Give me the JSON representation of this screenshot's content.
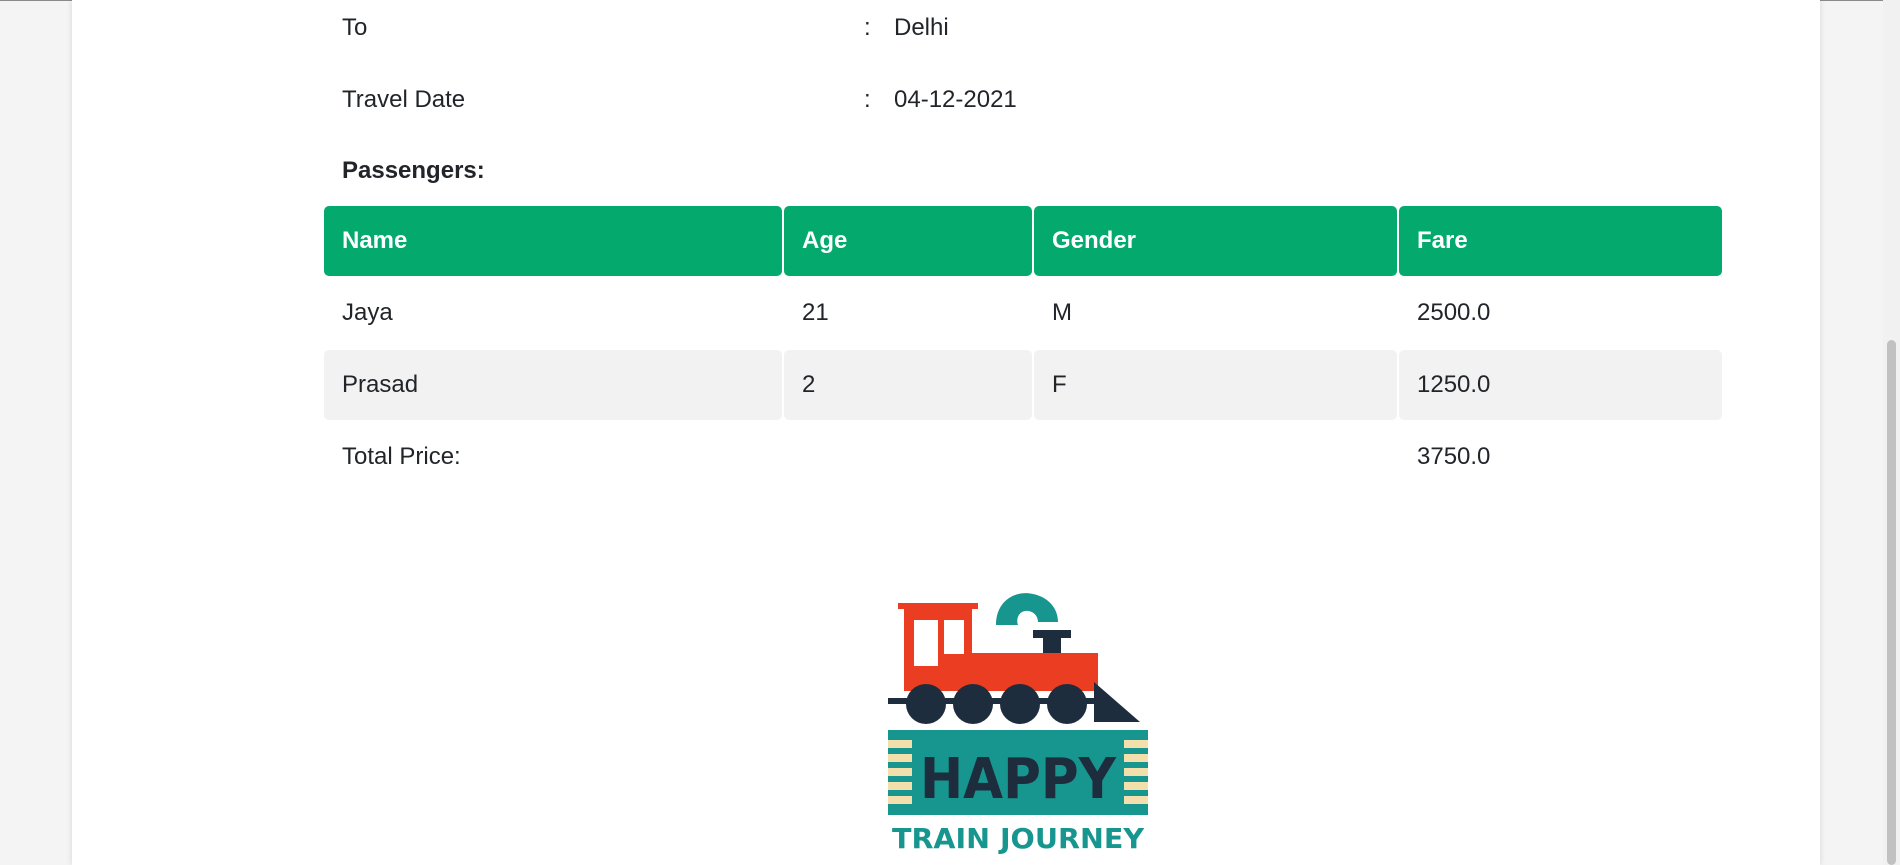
{
  "trip": {
    "to_label": "To",
    "to_value": "Delhi",
    "date_label": "Travel Date",
    "date_value": "04-12-2021",
    "separator": ":"
  },
  "passengers": {
    "heading": "Passengers:",
    "columns": [
      "Name",
      "Age",
      "Gender",
      "Fare"
    ],
    "rows": [
      {
        "name": "Jaya",
        "age": "21",
        "gender": "M",
        "fare": "2500.0"
      },
      {
        "name": "Prasad",
        "age": "2",
        "gender": "F",
        "fare": "1250.0"
      }
    ],
    "total_label": "Total Price:",
    "total_value": "3750.0"
  },
  "logo": {
    "line1": "HAPPY",
    "line2": "TRAIN JOURNEY",
    "icon": "train-icon"
  },
  "colors": {
    "header_green": "#04aa6d",
    "row_alt": "#f2f2f2",
    "logo_teal": "#17958f",
    "logo_red": "#ea3d22",
    "logo_navy": "#1e2d3d",
    "logo_cream": "#f3dfac"
  }
}
